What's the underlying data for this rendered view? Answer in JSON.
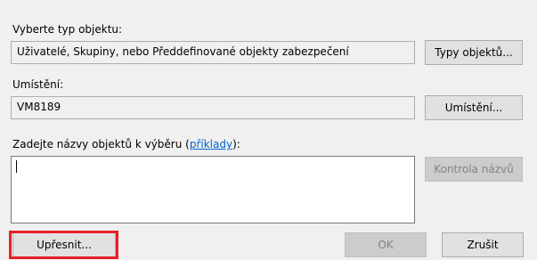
{
  "object_type": {
    "label": "Vyberte typ objektu:",
    "value": "Uživatelé, Skupiny, nebo Předdefinované objekty zabezpečení",
    "button": "Typy objektů..."
  },
  "location": {
    "label": "Umístění:",
    "value": "VM8189",
    "button": "Umístění..."
  },
  "names": {
    "label_prefix": "Zadejte názvy objektů k výběru (",
    "link": "příklady",
    "label_suffix": "):",
    "value": "",
    "check_button": "Kontrola názvů"
  },
  "footer": {
    "advanced": "Upřesnit...",
    "ok": "OK",
    "cancel": "Zrušit"
  },
  "colors": {
    "highlight": "#e8202a",
    "link": "#0066cc"
  }
}
